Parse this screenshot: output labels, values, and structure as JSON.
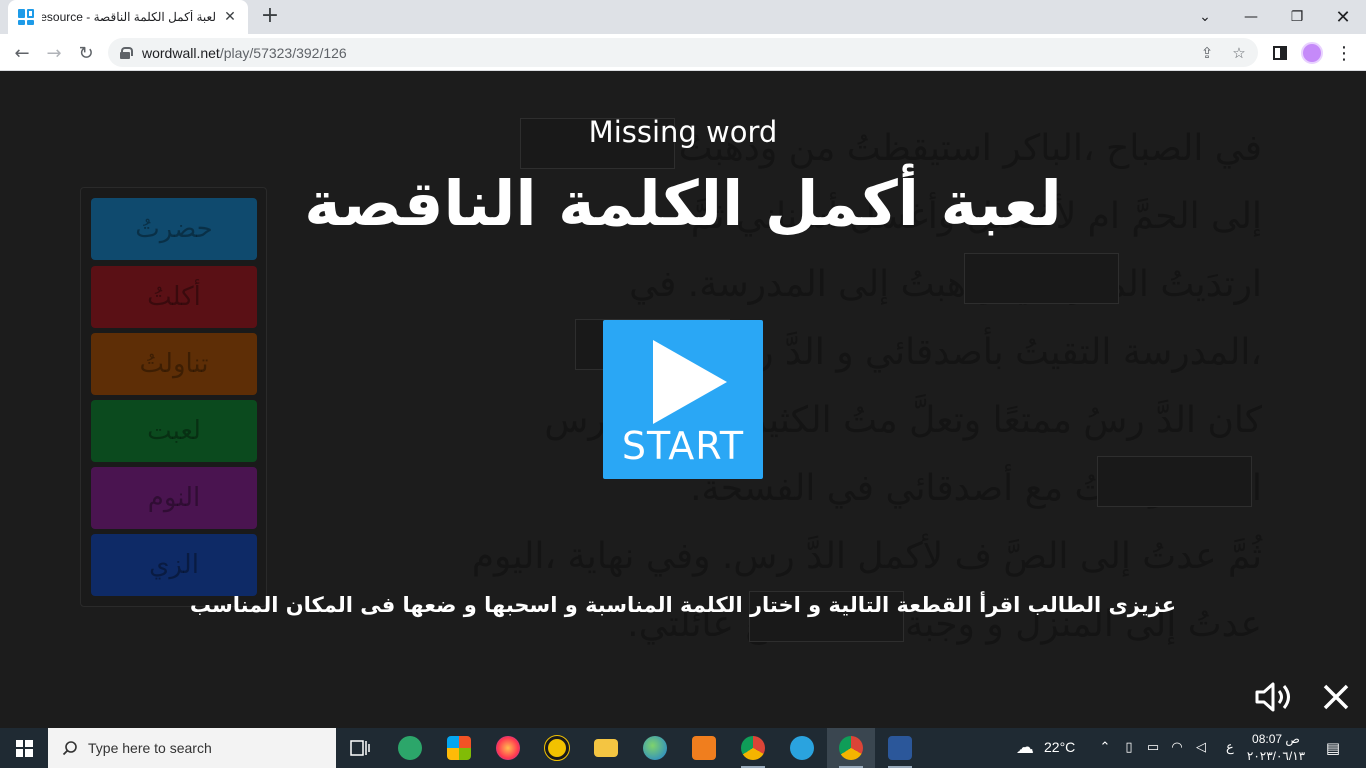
{
  "browser": {
    "tab_title": "لعبة أكمل الكلمة الناقصة - Resource",
    "url_domain": "wordwall.net",
    "url_path": "/play/57323/392/126"
  },
  "game": {
    "template_name": "Missing word",
    "title": "لعبة أكمل الكلمة الناقصة",
    "start_label": "START",
    "instructions": "عزيزى الطالب اقرأ القطعة التالية و اختار الكلمة المناسبة و اسحبها و ضعها فى المكان المناسب",
    "passage_lines": [
      "في الصباح ،الباكر استيقظتُ من              وذهبتُ",
      "إلى الحمَّ ام لأغتسل وأغسل أسناني ثمَّ",
      "ارتدَيتُ              المدرسي وذهبتُ إلى المدرسة. في",
      "،المدرسة التقيتُ بأصدقائي و              الدَّ رس.",
      "كان الدَّ رسُ ممتعًا وتعلَّ متُ الكثير. بعد ،الدَّ رس",
      "              الغداءَ ولعبتُ مع أصدقائي في الفسحة.",
      "ثُمَّ عدتُ إلى الصَّ ف لأكمل الدَّ رس. وفي نهاية ،اليوم",
      "عدتُ إلى المنزل و              وجبة العشاء مع عائلتي."
    ],
    "word_tiles": [
      {
        "label": "حضرتُ",
        "color": "#0f4a6e"
      },
      {
        "label": "أكلتُ",
        "color": "#5a1015"
      },
      {
        "label": "تناولتُ",
        "color": "#5e2e06"
      },
      {
        "label": "لعبت",
        "color": "#0b4a1e"
      },
      {
        "label": "النوم",
        "color": "#4a1450"
      },
      {
        "label": "الزي",
        "color": "#0e2a66"
      }
    ]
  },
  "taskbar": {
    "search_placeholder": "Type here to search",
    "weather": "22°C",
    "lang": "ع",
    "time": "08:07 ص",
    "date": "٢٠٢٣/٠٦/١٣"
  }
}
